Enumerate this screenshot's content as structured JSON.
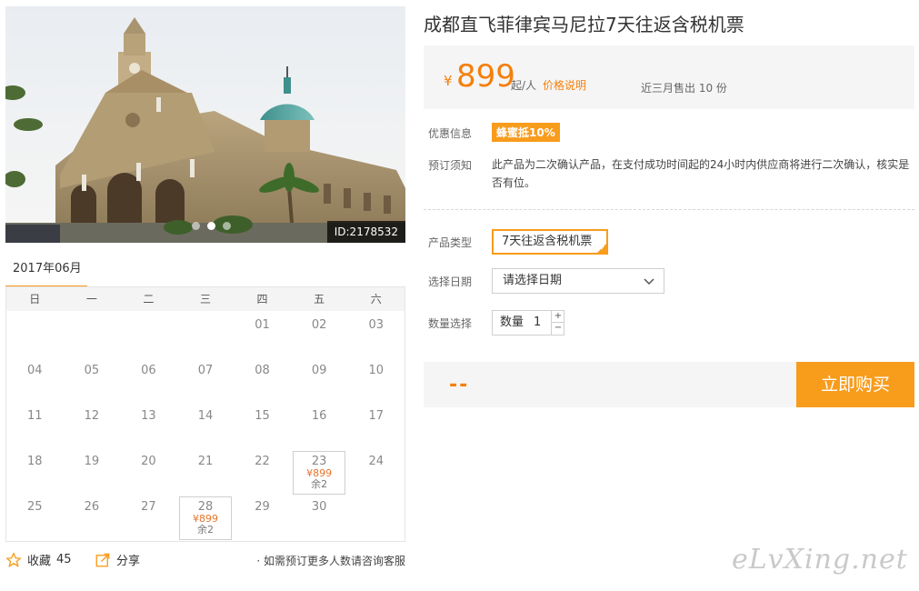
{
  "photo": {
    "id_label": "ID:2178532",
    "dots": 3,
    "active_dot": 1
  },
  "calendar": {
    "month": "2017年06月",
    "weekdays": [
      "日",
      "一",
      "二",
      "三",
      "四",
      "五",
      "六"
    ],
    "weeks": [
      [
        null,
        null,
        null,
        null,
        "01",
        "02",
        "03"
      ],
      [
        "04",
        "05",
        "06",
        "07",
        "08",
        "09",
        "10"
      ],
      [
        "11",
        "12",
        "13",
        "14",
        "15",
        "16",
        "17"
      ],
      [
        "18",
        "19",
        "20",
        "21",
        "22",
        "23",
        "24"
      ],
      [
        "25",
        "26",
        "27",
        "28",
        "29",
        "30",
        null
      ]
    ],
    "available": {
      "23": {
        "price": "¥899",
        "left": "余2"
      },
      "28": {
        "price": "¥899",
        "left": "余2"
      }
    }
  },
  "footer": {
    "favorite_label": "收藏",
    "favorite_count": "45",
    "share_label": "分享",
    "consult_text": "· 如需预订更多人数请咨询客服"
  },
  "product": {
    "title": "成都直飞菲律宾马尼拉7天往返含税机票",
    "price_currency": "¥",
    "price": "899",
    "price_unit": "起/人",
    "price_explain": "价格说明",
    "sold_text": "近三月售出 10 份",
    "promo_label": "优惠信息",
    "promo_badge": "蜂蜜抵10%",
    "notice_label": "预订须知",
    "notice_text": "此产品为二次确认产品，在支付成功时间起的24小时内供应商将进行二次确认，核实是否有位。",
    "type_label": "产品类型",
    "type_value": "7天往返含税机票",
    "date_label": "选择日期",
    "date_placeholder": "请选择日期",
    "qty_label": "数量选择",
    "qty_field_label": "数量",
    "qty_value": "1",
    "qty_plus": "+",
    "qty_minus": "−",
    "total_placeholder": "--",
    "buy_label": "立即购买"
  },
  "watermark": "eLvXing.net",
  "colors": {
    "accent": "#f89c1c",
    "price": "#f57f0a"
  }
}
